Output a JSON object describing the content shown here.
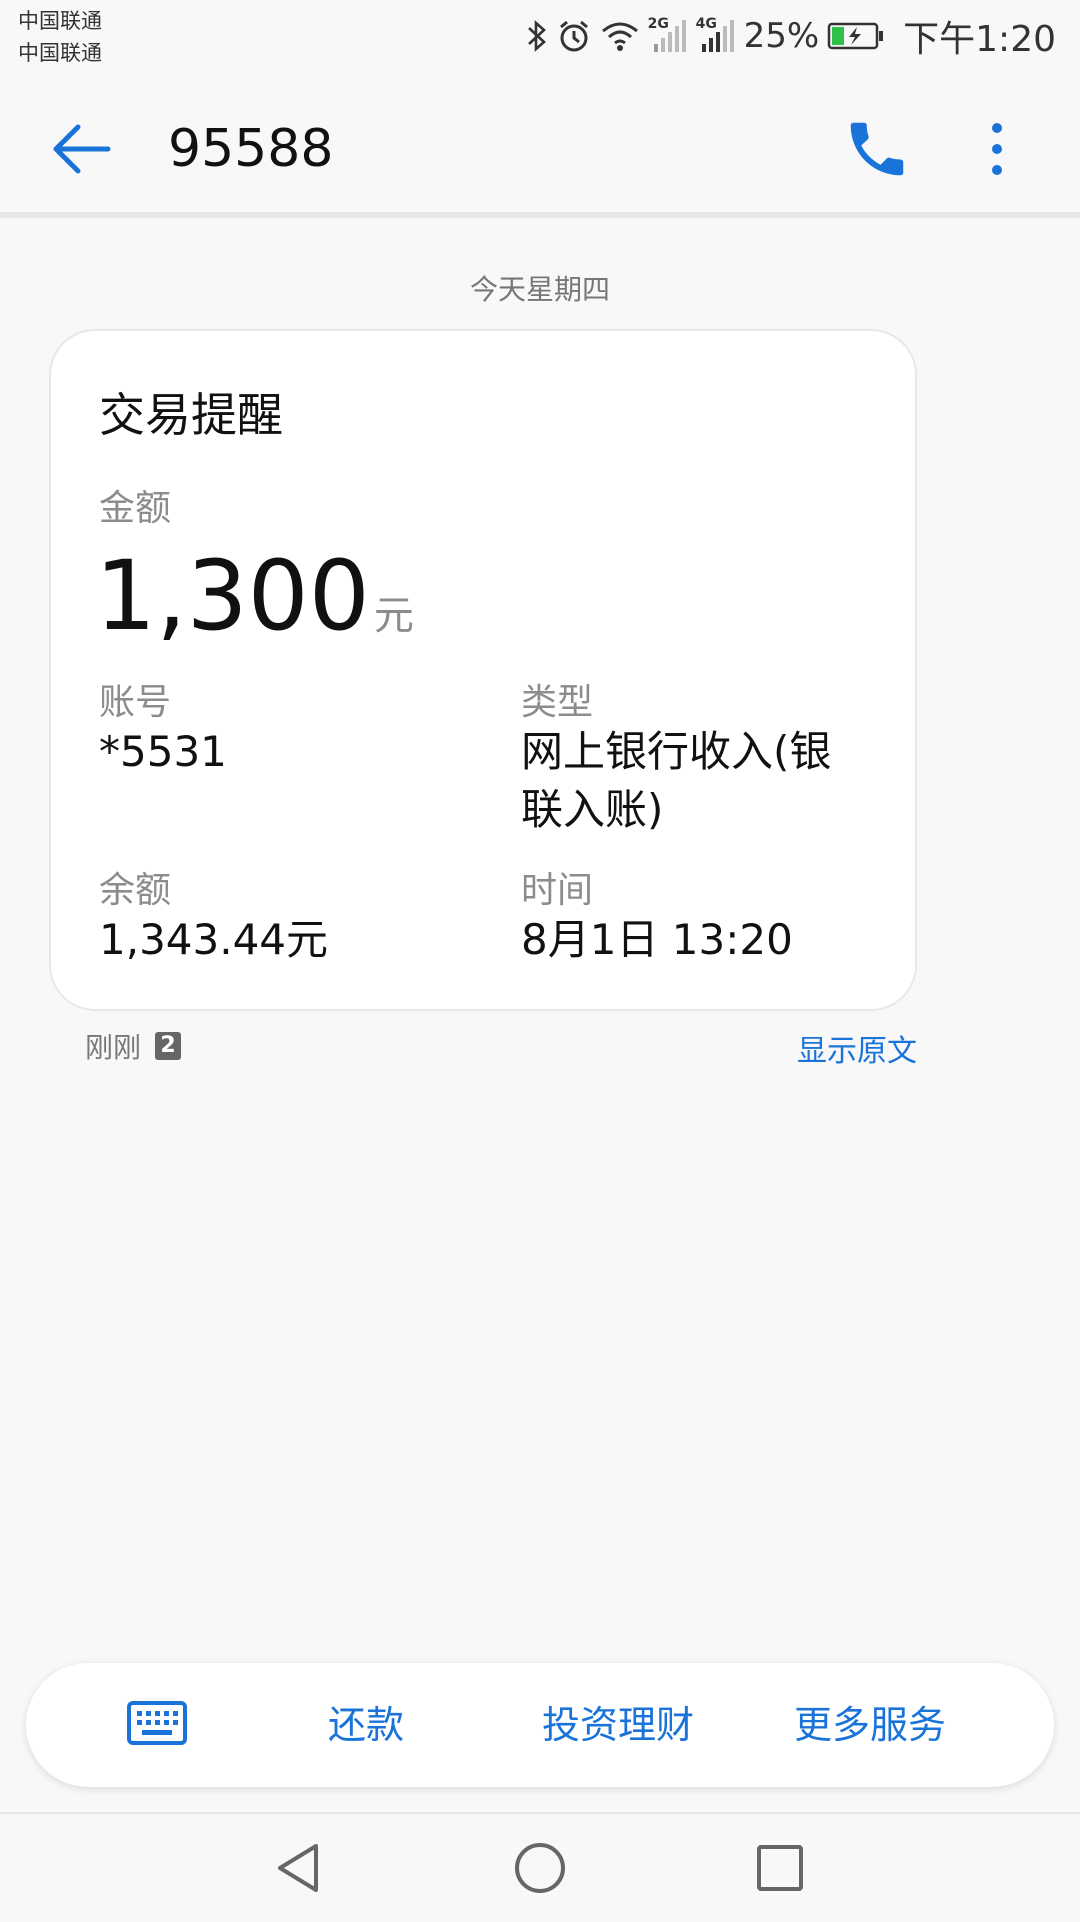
{
  "status_bar": {
    "carrier_1": "中国联通",
    "carrier_2": "中国联通",
    "network_1": "2G",
    "network_2": "4G",
    "battery_percent": "25%",
    "time": "下午1:20",
    "icons": [
      "bluetooth-icon",
      "alarm-icon",
      "wifi-icon",
      "signal-icon",
      "battery-charging-icon"
    ]
  },
  "app_bar": {
    "title": "95588",
    "icons": [
      "back-arrow-icon",
      "phone-icon",
      "more-vert-icon"
    ],
    "accent_color": "#1a73d9"
  },
  "date_separator": "今天星期四",
  "message_card": {
    "title": "交易提醒",
    "amount_label": "金额",
    "amount_value": "1,300",
    "amount_unit": "元",
    "account_label": "账号",
    "account_value": "*5531",
    "type_label": "类型",
    "type_value_line1": "网上银行收入(银",
    "type_value_line2": "联入账)",
    "balance_label": "余额",
    "balance_value": "1,343.44元",
    "time_label": "时间",
    "time_value": "8月1日 13:20"
  },
  "message_meta": {
    "sent_time": "刚刚",
    "sim_badge": "2",
    "show_original": "显示原文"
  },
  "service_bar": {
    "keyboard_icon": "keyboard-icon",
    "items": [
      "还款",
      "投资理财",
      "更多服务"
    ]
  },
  "nav_bar": {
    "icons": [
      "back-triangle-icon",
      "home-circle-icon",
      "recents-square-icon"
    ]
  }
}
